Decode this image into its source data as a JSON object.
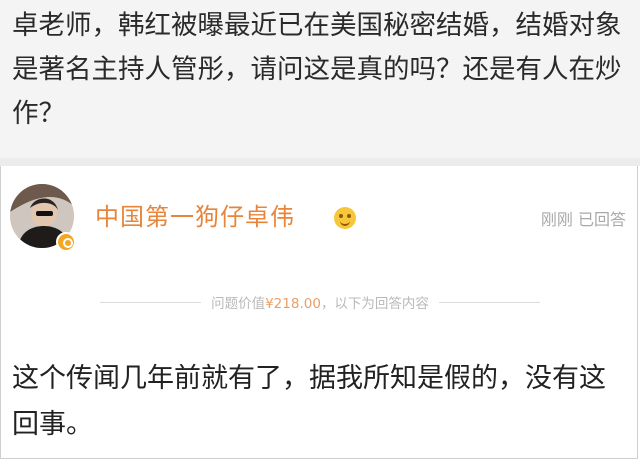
{
  "question": {
    "text": "卓老师，韩红被曝最近已在美国秘密结婚，结婚对象是著名主持人管彤，请问这是真的吗？还是有人在炒作？"
  },
  "answerer": {
    "username": "中国第一狗仔卓伟",
    "status": "刚刚 已回答",
    "avatar_icon": "avatar-image",
    "verified_icon": "verified-badge-icon",
    "badge_icon": "emoji-badge-icon"
  },
  "price": {
    "prefix": "问题价值",
    "amount": "¥218.00",
    "suffix": "，以下为回答内容"
  },
  "answer": {
    "text": "这个传闻几年前就有了，据我所知是假的，没有这回事。"
  },
  "colors": {
    "username": "#e8853a",
    "question_bg": "#f4f4f4",
    "muted": "#a9a9a9"
  }
}
